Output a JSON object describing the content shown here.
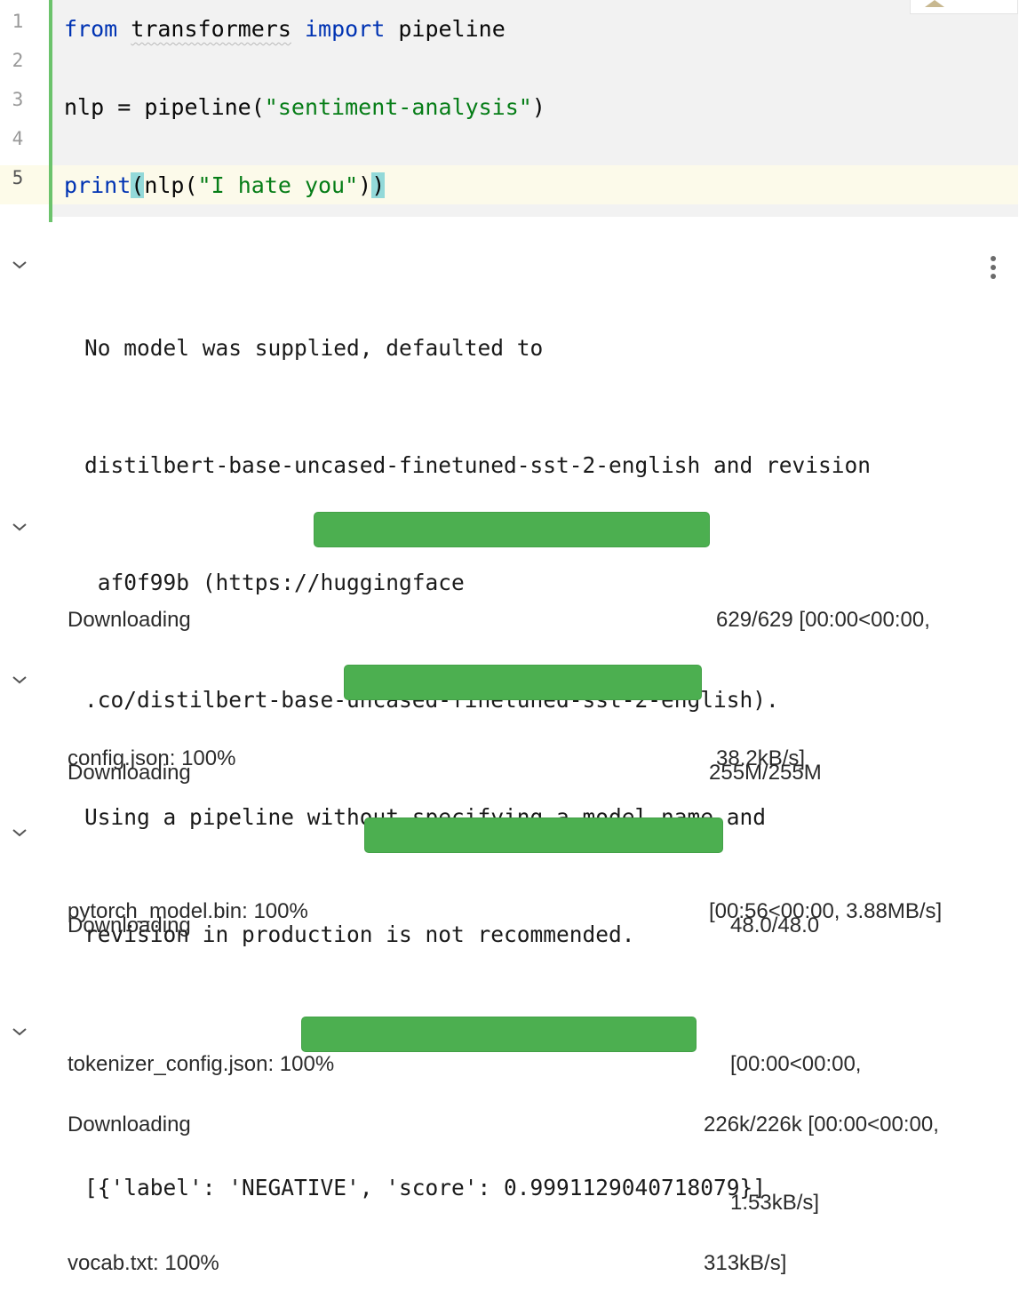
{
  "code_cell": {
    "line_numbers": [
      "1",
      "2",
      "3",
      "4",
      "5"
    ],
    "line1": {
      "kw1": "from",
      "module": "transformers",
      "kw2": "import",
      "name": "pipeline"
    },
    "line3": {
      "var": "nlp",
      "op": " = ",
      "func": "pipeline",
      "open": "(",
      "arg": "\"sentiment-analysis\"",
      "close": ")"
    },
    "line5": {
      "builtin": "print",
      "open": "(",
      "func": "nlp",
      "inner_open": "(",
      "arg": "\"I hate you\"",
      "inner_close": ")",
      "close": ")"
    }
  },
  "stderr_output": {
    "lines": [
      "No model was supplied, defaulted to",
      "distilbert-base-uncased-finetuned-sst-2-english and revision",
      " af0f99b (https://huggingface",
      ".co/distilbert-base-uncased-finetuned-sst-2-english).",
      "Using a pipeline without specifying a model name and",
      "revision in production is not recommended."
    ]
  },
  "downloads": [
    {
      "label_lines": [
        "Downloading",
        "config.json: 100%"
      ],
      "progress": 1.0,
      "stats_lines": [
        "629/629 [00:00<00:00,",
        "38.2kB/s]"
      ]
    },
    {
      "label_lines": [
        "Downloading",
        "pytorch_model.bin: 100%"
      ],
      "progress": 1.0,
      "stats_lines": [
        "255M/255M",
        "[00:56<00:00, 3.88MB/s]"
      ]
    },
    {
      "label_lines": [
        "Downloading",
        "tokenizer_config.json: 100%"
      ],
      "progress": 1.0,
      "stats_lines": [
        "48.0/48.0",
        "[00:00<00:00,",
        "1.53kB/s]"
      ]
    },
    {
      "label_lines": [
        "Downloading",
        "vocab.txt: 100%"
      ],
      "progress": 1.0,
      "stats_lines": [
        "226k/226k [00:00<00:00,",
        "313kB/s]"
      ]
    }
  ],
  "result_output": {
    "text": "[{'label': 'NEGATIVE', 'score': 0.9991129040718079}]"
  },
  "colors": {
    "progress_bar": "#4caf50",
    "keyword": "#0033b3",
    "string": "#067d17",
    "change_bar": "#6cc36c"
  }
}
